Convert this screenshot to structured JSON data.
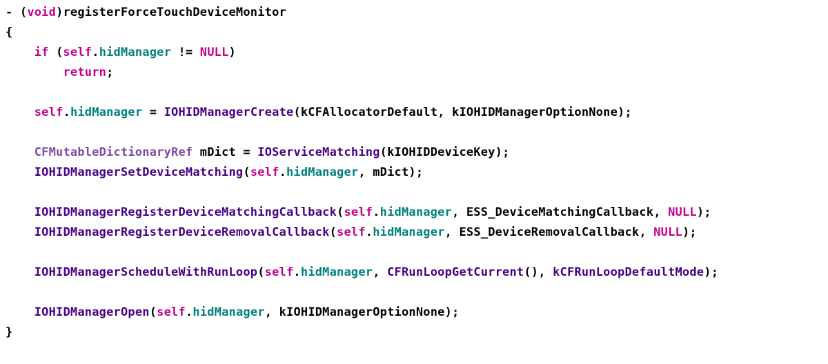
{
  "kw": {
    "void": "void",
    "if": "if",
    "return": "return",
    "self": "self",
    "null": "NULL"
  },
  "type": {
    "cfmdr": "CFMutableDictionaryRef"
  },
  "prop": {
    "hidManager": "hidManager"
  },
  "fn": {
    "IOHIDManagerCreate": "IOHIDManagerCreate",
    "IOServiceMatching": "IOServiceMatching",
    "IOHIDManagerSetDeviceMatching": "IOHIDManagerSetDeviceMatching",
    "IOHIDManagerRegisterDeviceMatchingCallback": "IOHIDManagerRegisterDeviceMatchingCallback",
    "IOHIDManagerRegisterDeviceRemovalCallback": "IOHIDManagerRegisterDeviceRemovalCallback",
    "IOHIDManagerScheduleWithRunLoop": "IOHIDManagerScheduleWithRunLoop",
    "CFRunLoopGetCurrent": "CFRunLoopGetCurrent",
    "IOHIDManagerOpen": "IOHIDManagerOpen"
  },
  "txt": {
    "methodName": "registerForceTouchDeviceMonitor",
    "kCFAllocatorDefault": "kCFAllocatorDefault",
    "kIOHIDManagerOptionNone": "kIOHIDManagerOptionNone",
    "mDict": "mDict",
    "kIOHIDDeviceKey": "kIOHIDDeviceKey",
    "ESS_DeviceMatchingCallback": "ESS_DeviceMatchingCallback",
    "ESS_DeviceRemovalCallback": "ESS_DeviceRemovalCallback",
    "kCFRunLoopDefaultMode": "kCFRunLoopDefaultMode"
  },
  "p": {
    "dash": "- ",
    "lp": "(",
    "rp": ")",
    "lb": "{",
    "rb": "}",
    "sc": ";",
    "dot": ".",
    "cm": ", ",
    "eq": " = ",
    "ne": " != "
  }
}
